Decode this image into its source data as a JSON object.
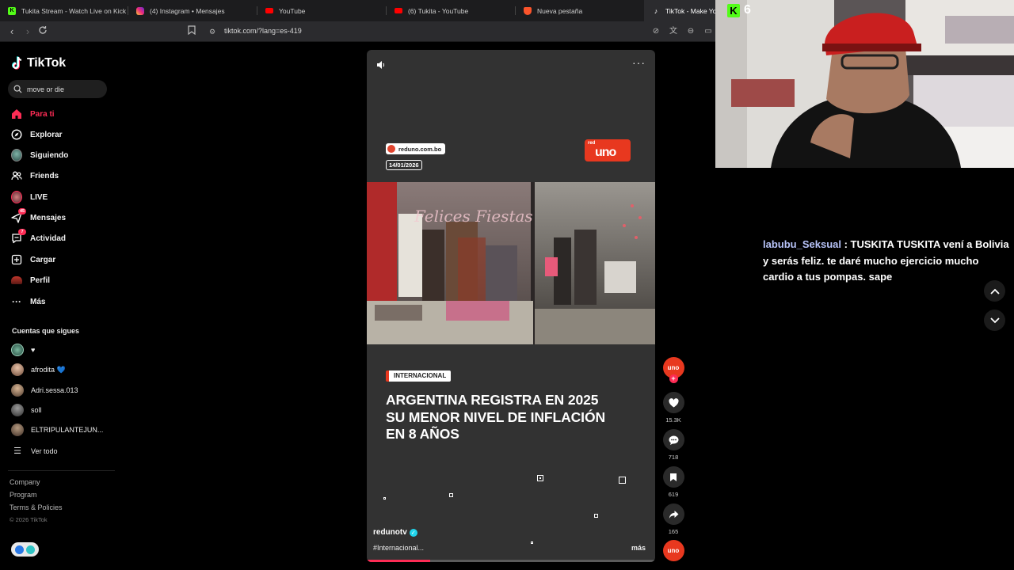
{
  "browser": {
    "tabs": [
      {
        "title": "Tukita Stream - Watch Live on Kick",
        "icon": "kick-icon",
        "color": "#53fc18"
      },
      {
        "title": "(4) Instagram • Mensajes",
        "icon": "instagram-icon",
        "color": "#d6249f"
      },
      {
        "title": "YouTube",
        "icon": "youtube-icon",
        "color": "#ff0000"
      },
      {
        "title": "(6) Tukita - YouTube",
        "icon": "youtube-icon",
        "color": "#ff0000"
      },
      {
        "title": "Nueva pestaña",
        "icon": "brave-icon",
        "color": "#fb542b"
      },
      {
        "title": "TikTok - Make You",
        "icon": "tiktok-icon",
        "color": "#ffffff"
      }
    ],
    "url": "tiktok.com/?lang=es-419"
  },
  "tiktok": {
    "logo_text": "TikTok",
    "search": {
      "value": "move or die"
    },
    "nav": [
      {
        "label": "Para ti",
        "icon": "home-icon",
        "active": true
      },
      {
        "label": "Explorar",
        "icon": "compass-icon"
      },
      {
        "label": "Siguiendo",
        "icon": "following-icon"
      },
      {
        "label": "Friends",
        "icon": "friends-icon"
      },
      {
        "label": "LIVE",
        "icon": "live-icon"
      },
      {
        "label": "Mensajes",
        "icon": "messages-icon",
        "badge": "45"
      },
      {
        "label": "Actividad",
        "icon": "activity-icon",
        "badge": "7"
      },
      {
        "label": "Cargar",
        "icon": "upload-icon"
      },
      {
        "label": "Perfil",
        "icon": "profile-icon"
      },
      {
        "label": "Más",
        "icon": "more-icon"
      }
    ],
    "following_title": "Cuentas que sigues",
    "following": [
      {
        "name": "♥"
      },
      {
        "name": "afrodita 💙"
      },
      {
        "name": "Adri.sessa.013"
      },
      {
        "name": "soll"
      },
      {
        "name": "ELTRIPULANTEJUN..."
      },
      {
        "name": "Ver todo"
      }
    ],
    "footer": {
      "links": [
        "Company",
        "Program",
        "Terms & Policies"
      ],
      "copyright": "© 2026 TikTok"
    }
  },
  "video": {
    "source": "reduno.com.bo",
    "date": "14/01/2026",
    "channel_logo_small": "red",
    "channel_logo": "uno",
    "tag": "INTERNACIONAL",
    "headline": "ARGENTINA REGISTRA EN 2025 SU MENOR NIVEL DE INFLACIÓN EN 8 AÑOS",
    "username": "redunotv",
    "caption": "#Internacional...",
    "more": "más",
    "progress": 0.22
  },
  "actions": {
    "creator_label": "uno",
    "likes": "15.3K",
    "comments": "718",
    "saves": "619",
    "shares": "165",
    "music_label": "uno"
  },
  "stream": {
    "viewer_count": "6",
    "chat": {
      "username": "labubu_Seksual",
      "message": " : TUSKITA TUSKITA vení a Bolivia y serás feliz. te daré mucho ejercicio mucho cardio a tus pompas. sape"
    }
  }
}
